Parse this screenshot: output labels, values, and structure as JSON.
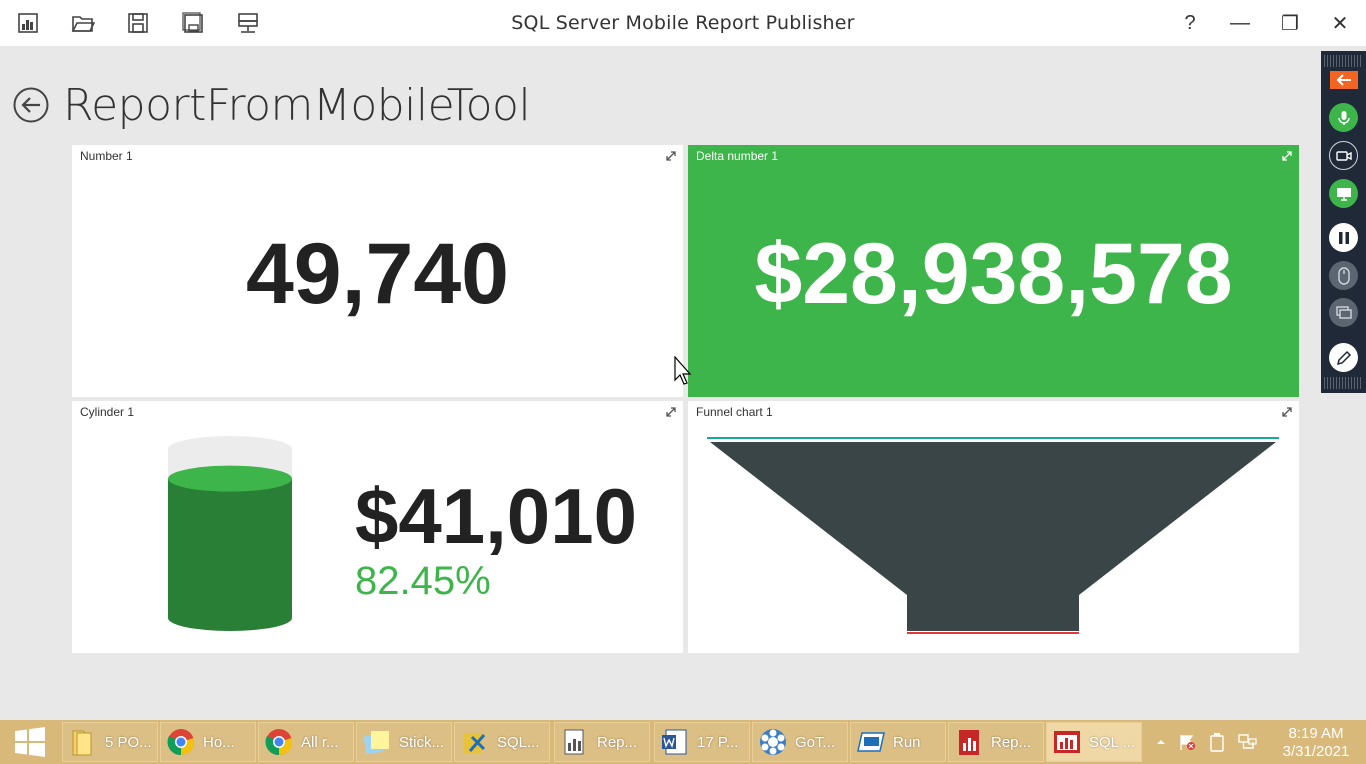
{
  "window": {
    "title": "SQL Server Mobile Report Publisher",
    "help": "?",
    "minimize": "—",
    "restore": "❐",
    "close": "✕",
    "toolbar_icons": [
      "new-report-icon",
      "open-folder-icon",
      "save-icon",
      "save-as-icon",
      "publish-server-icon"
    ]
  },
  "report": {
    "title": "ReportFromMobileTool"
  },
  "tiles": {
    "number": {
      "label": "Number 1",
      "value": "49,740"
    },
    "delta": {
      "label": "Delta number 1",
      "value": "$28,938,578",
      "color": "#3db54a"
    },
    "cylinder": {
      "label": "Cylinder 1",
      "value": "$41,010",
      "percent": "82.45%",
      "fill_fraction": 0.8245,
      "fill_color": "#2a7f36",
      "top_color": "#3db54a",
      "percent_color": "#3db54a"
    },
    "funnel": {
      "label": "Funnel chart 1",
      "fill_color": "#3a4548",
      "top_line_color": "#1aa89a",
      "bottom_line_color": "#e0393e"
    }
  },
  "sidebar": {
    "icons": [
      "arrow-left-icon",
      "microphone-icon",
      "video-camera-icon",
      "screen-share-icon",
      "pause-icon",
      "mouse-icon",
      "windows-icon",
      "pen-icon"
    ]
  },
  "taskbar": {
    "items": [
      {
        "label": "5 PO...",
        "icon": "folder-icon"
      },
      {
        "label": "Ho...",
        "icon": "chrome-icon"
      },
      {
        "label": "All r...",
        "icon": "chrome-icon"
      },
      {
        "label": "Stick...",
        "icon": "sticky-notes-icon"
      },
      {
        "label": "SQL...",
        "icon": "sql-tools-icon"
      },
      {
        "label": "Rep...",
        "icon": "report-builder-icon"
      },
      {
        "label": "17 P...",
        "icon": "word-icon"
      },
      {
        "label": "GoT...",
        "icon": "gotomeeting-icon"
      },
      {
        "label": "Run",
        "icon": "run-icon"
      },
      {
        "label": "Rep...",
        "icon": "report-icon"
      },
      {
        "label": "SQL ...",
        "icon": "mobile-report-publisher-icon"
      }
    ],
    "time": "8:19 AM",
    "date": "3/31/2021"
  }
}
